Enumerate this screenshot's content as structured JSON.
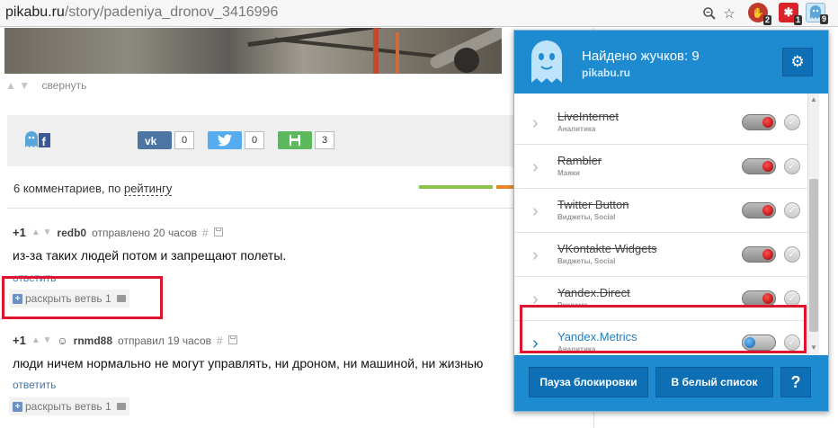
{
  "browser": {
    "url_host": "pikabu.ru",
    "url_path": "/story/padeniya_dronov_3416996",
    "extensions": [
      {
        "name": "adblock",
        "badge": "2",
        "color": "#c0392b"
      },
      {
        "name": "puzzle",
        "badge": "1",
        "color": "#d9222a"
      },
      {
        "name": "ghostery",
        "badge": "9",
        "color": "#5aa6d8"
      }
    ]
  },
  "post": {
    "collapse_label": "свернуть",
    "share": [
      {
        "network": "vk",
        "label": "вк",
        "count": "0",
        "color": "#4c75a3"
      },
      {
        "network": "twitter",
        "label": "",
        "count": "0",
        "color": "#55acee"
      },
      {
        "network": "save",
        "label": "",
        "count": "3",
        "color": "#5cb85c"
      }
    ]
  },
  "comments_header": {
    "prefix": "6 комментариев, по ",
    "sort_link": "рейтингу"
  },
  "comments": [
    {
      "score": "+1",
      "author": "redb0",
      "meta": "отправлено 20 часов",
      "text": "из-за таких людей потом и запрещают полеты.",
      "reply": "ответить",
      "expand": "раскрыть ветвь 1"
    },
    {
      "score": "+1",
      "author": "rnmd88",
      "meta": "отправил 19 часов",
      "text": "люди ничем нормально не могут управлять, ни дроном, ни машиной, ни жизнью",
      "reply": "ответить",
      "expand": "раскрыть ветвь 1"
    }
  ],
  "ghostery": {
    "title": "Найдено жучков: 9",
    "site": "pikabu.ru",
    "trackers": [
      {
        "name": "LiveInternet",
        "category": "Аналитика",
        "blocked": true
      },
      {
        "name": "Rambler",
        "category": "Маяки",
        "blocked": true
      },
      {
        "name": "Twitter Button",
        "category": "Виджеты,  Social",
        "blocked": true
      },
      {
        "name": "VKontakte Widgets",
        "category": "Виджеты,  Social",
        "blocked": true
      },
      {
        "name": "Yandex.Direct",
        "category": "Реклама",
        "blocked": true
      },
      {
        "name": "Yandex.Metrics",
        "category": "Аналитика",
        "blocked": false
      }
    ],
    "pause_label": "Пауза блокировки",
    "whitelist_label": "В белый список",
    "help_label": "?"
  },
  "colors": {
    "ghostery_blue": "#1e8bd0",
    "highlight_red": "#e0142e",
    "link_blue": "#3c78b0"
  }
}
